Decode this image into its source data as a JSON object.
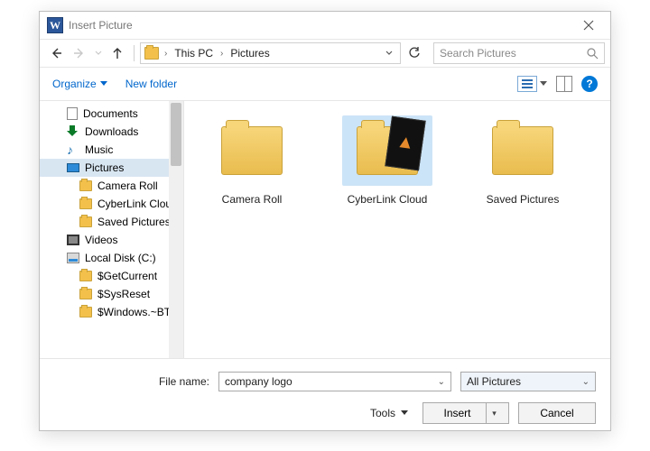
{
  "title": "Insert Picture",
  "breadcrumb": {
    "root": "This PC",
    "current": "Pictures"
  },
  "search": {
    "placeholder": "Search Pictures"
  },
  "toolbar": {
    "organize": "Organize",
    "newfolder": "New folder"
  },
  "tree": {
    "documents": "Documents",
    "downloads": "Downloads",
    "music": "Music",
    "pictures": "Pictures",
    "cameraroll": "Camera Roll",
    "cyberlink": "CyberLink Cloud",
    "savedpictures": "Saved Pictures",
    "videos": "Videos",
    "localdisk": "Local Disk (C:)",
    "getcurrent": "$GetCurrent",
    "sysreset": "$SysReset",
    "windowsbt": "$Windows.~BT"
  },
  "pane": {
    "items": [
      {
        "label": "Camera Roll"
      },
      {
        "label": "CyberLink Cloud"
      },
      {
        "label": "Saved Pictures"
      }
    ]
  },
  "footer": {
    "filename_label": "File name:",
    "filename_value": "company logo",
    "filter": "All Pictures",
    "tools": "Tools",
    "insert": "Insert",
    "cancel": "Cancel"
  }
}
